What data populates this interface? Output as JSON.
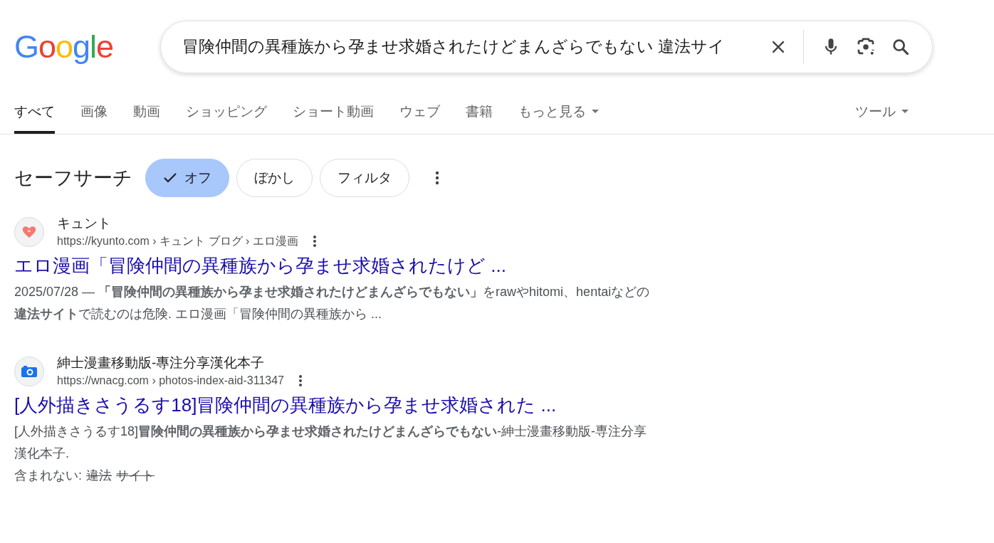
{
  "logo": "Google",
  "search": {
    "value": "冒険仲間の異種族から孕ませ求婚されたけどまんざらでもない 違法サイ"
  },
  "tabs": [
    {
      "label": "すべて",
      "selected": true,
      "kind": "plain"
    },
    {
      "label": "画像",
      "selected": false,
      "kind": "plain"
    },
    {
      "label": "動画",
      "selected": false,
      "kind": "plain"
    },
    {
      "label": "ショッピング",
      "selected": false,
      "kind": "plain"
    },
    {
      "label": "ショート動画",
      "selected": false,
      "kind": "plain"
    },
    {
      "label": "ウェブ",
      "selected": false,
      "kind": "plain"
    },
    {
      "label": "書籍",
      "selected": false,
      "kind": "plain"
    },
    {
      "label": "もっと見る",
      "selected": false,
      "kind": "menu"
    }
  ],
  "tools": {
    "label": "ツール"
  },
  "safe_search": {
    "label": "セーフサーチ",
    "options": [
      {
        "label": "オフ",
        "selected": true
      },
      {
        "label": "ぼかし",
        "selected": false
      },
      {
        "label": "フィルタ",
        "selected": false
      }
    ]
  },
  "results": [
    {
      "kind": "heart",
      "site": "キュント",
      "url": "https://kyunto.com › キュント ブログ › エロ漫画",
      "title": "エロ漫画「冒険仲間の異種族から孕ませ求婚されたけど ...",
      "date": "2025/07/28 — ",
      "snippet": "**「冒険仲間の異種族から孕ませ求婚されたけどまんざらでもない」**をrawやhitomi、hentaiなどの**違法サイト**で読むのは危険. エロ漫画「冒険仲間の異種族から ..."
    },
    {
      "kind": "camera",
      "site": "紳士漫畫移動版-專注分享漢化本子",
      "url": "https://wnacg.com › photos-index-aid-311347",
      "title": "[人外描きさうるす18]冒険仲間の異種族から孕ませ求婚された ...",
      "snippet": "[人外描きさうるす18]**冒険仲間の異種族から孕ませ求婚されたけどまんざらでもない**-紳士漫畫移動版-専注分享漢化本子.",
      "missing": {
        "label": "含まれない:",
        "terms": [
          "違法",
          "サイト"
        ]
      }
    }
  ]
}
